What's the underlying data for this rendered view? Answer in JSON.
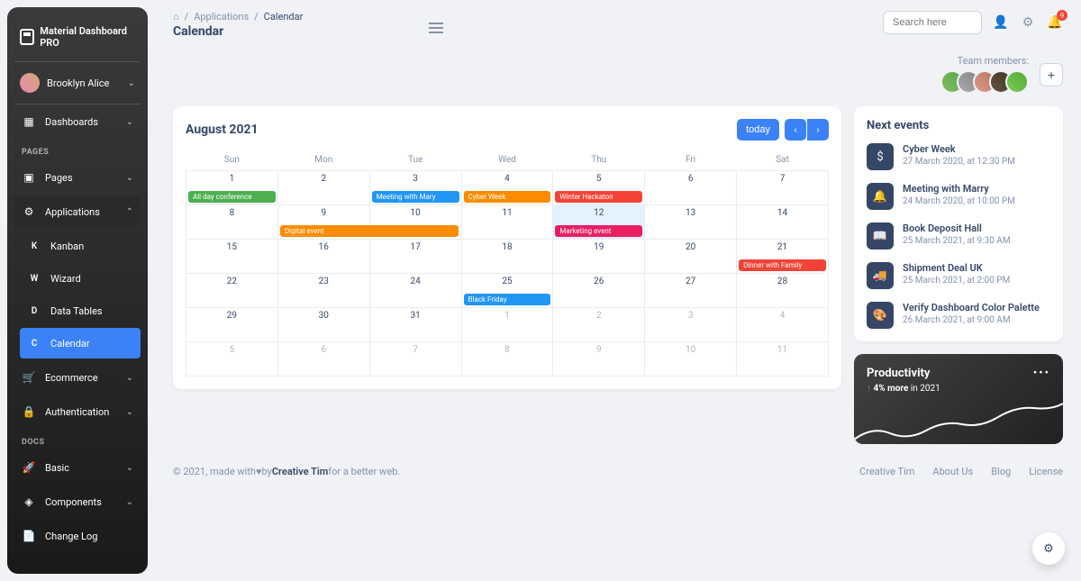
{
  "brand": "Material Dashboard PRO",
  "user": {
    "name": "Brooklyn Alice"
  },
  "sidebar": {
    "dashboards": "Dashboards",
    "section_pages": "PAGES",
    "pages": "Pages",
    "applications": "Applications",
    "kanban": {
      "letter": "K",
      "label": "Kanban"
    },
    "wizard": {
      "letter": "W",
      "label": "Wizard"
    },
    "datatables": {
      "letter": "D",
      "label": "Data Tables"
    },
    "calendar": {
      "letter": "C",
      "label": "Calendar"
    },
    "ecommerce": "Ecommerce",
    "authentication": "Authentication",
    "section_docs": "DOCS",
    "basic": "Basic",
    "components": "Components",
    "changelog": "Change Log"
  },
  "breadcrumb": {
    "applications": "Applications",
    "current": "Calendar"
  },
  "page_title": "Calendar",
  "search_placeholder": "Search here",
  "notification_count": "9",
  "team_label": "Team members:",
  "calendar": {
    "title": "August 2021",
    "today": "today",
    "days": [
      "Sun",
      "Mon",
      "Tue",
      "Wed",
      "Thu",
      "Fri",
      "Sat"
    ],
    "weeks": [
      [
        {
          "n": "1"
        },
        {
          "n": "2"
        },
        {
          "n": "3"
        },
        {
          "n": "4"
        },
        {
          "n": "5"
        },
        {
          "n": "6"
        },
        {
          "n": "7"
        }
      ],
      [
        {
          "n": "8"
        },
        {
          "n": "9"
        },
        {
          "n": "10"
        },
        {
          "n": "11"
        },
        {
          "n": "12"
        },
        {
          "n": "13"
        },
        {
          "n": "14"
        }
      ],
      [
        {
          "n": "15"
        },
        {
          "n": "16"
        },
        {
          "n": "17"
        },
        {
          "n": "18"
        },
        {
          "n": "19"
        },
        {
          "n": "20"
        },
        {
          "n": "21"
        }
      ],
      [
        {
          "n": "22"
        },
        {
          "n": "23"
        },
        {
          "n": "24"
        },
        {
          "n": "25"
        },
        {
          "n": "26"
        },
        {
          "n": "27"
        },
        {
          "n": "28"
        }
      ],
      [
        {
          "n": "29"
        },
        {
          "n": "30"
        },
        {
          "n": "31"
        },
        {
          "n": "1"
        },
        {
          "n": "2"
        },
        {
          "n": "3"
        },
        {
          "n": "4"
        }
      ],
      [
        {
          "n": "5"
        },
        {
          "n": "6"
        },
        {
          "n": "7"
        },
        {
          "n": "8"
        },
        {
          "n": "9"
        },
        {
          "n": "10"
        },
        {
          "n": "11"
        }
      ]
    ],
    "events": {
      "allday": "All day conference",
      "meeting_mary": "Meeting with Mary",
      "cyber_week": "Cyber Week",
      "winter": "Winter Hackaton",
      "digital": "Digital event",
      "marketing": "Marketing event",
      "dinner": "Dinner with Family",
      "black_friday": "Black Friday"
    }
  },
  "next_events": {
    "title": "Next events",
    "items": [
      {
        "name": "Cyber Week",
        "date": "27 March 2020, at 12:30 PM",
        "icon": "$"
      },
      {
        "name": "Meeting with Marry",
        "date": "24 March 2020, at 10:00 PM",
        "icon": "🔔"
      },
      {
        "name": "Book Deposit Hall",
        "date": "25 March 2021, at 9:30 AM",
        "icon": "📖"
      },
      {
        "name": "Shipment Deal UK",
        "date": "25 March 2021, at 2:00 PM",
        "icon": "🚚"
      },
      {
        "name": "Verify Dashboard Color Palette",
        "date": "26 March 2021, at 9:00 AM",
        "icon": "🎨"
      }
    ]
  },
  "productivity": {
    "title": "Productivity",
    "arrow": "↑",
    "percent": "4% more",
    "suffix": "in 2021"
  },
  "footer": {
    "copyright_prefix": "© 2021, made with ",
    "by": " by ",
    "creative_tim": "Creative Tim",
    "suffix": " for a better web.",
    "links": [
      "Creative Tim",
      "About Us",
      "Blog",
      "License"
    ]
  }
}
